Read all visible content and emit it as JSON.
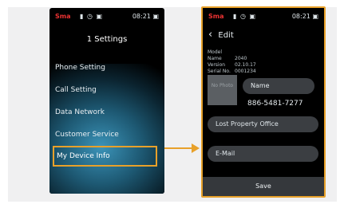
{
  "settings_screen": {
    "status": {
      "carrier": "Sma",
      "icons": "▮ ◷ ▣",
      "time": "08:21 ▣"
    },
    "title": "1 Settings",
    "menu": [
      {
        "label": "Phone Setting"
      },
      {
        "label": "Call Setting"
      },
      {
        "label": "Data Network"
      },
      {
        "label": "Customer Service"
      },
      {
        "label": "My Device Info",
        "selected": true
      }
    ]
  },
  "device_info_screen": {
    "status": {
      "carrier": "Sma",
      "icons": "▮ ◷ ▣",
      "time": "08:21 ▣"
    },
    "back_label": "Edit",
    "info_rows": [
      {
        "label": "Model Name",
        "value": "2040"
      },
      {
        "label": "Version",
        "value": "02.10.17"
      },
      {
        "label": "Serial No.",
        "value": "0001234"
      }
    ],
    "photo_label": "No Photo",
    "name_placeholder": "Name",
    "phone_number": "886-5481-7277",
    "office_placeholder": "Lost Property Office",
    "email_placeholder": "E-Mail",
    "save_label": "Save"
  },
  "colors": {
    "highlight": "#e8a12a",
    "background": "#f0f0f1"
  }
}
